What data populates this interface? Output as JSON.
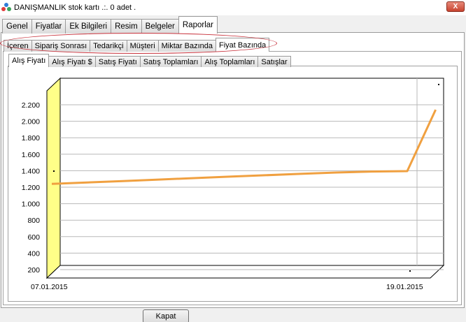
{
  "window": {
    "title": "DANIŞMANLIK stok kartı    .:.   0 adet .",
    "close_label": "X"
  },
  "main_tabs": [
    {
      "label": "Genel",
      "active": false
    },
    {
      "label": "Fiyatlar",
      "active": false
    },
    {
      "label": "Ek Bilgileri",
      "active": false
    },
    {
      "label": "Resim",
      "active": false
    },
    {
      "label": "Belgeler",
      "active": false
    },
    {
      "label": "Raporlar",
      "active": true
    }
  ],
  "sub_tabs": [
    {
      "label": "İçeren",
      "active": false
    },
    {
      "label": "Sipariş Sonrası",
      "active": false
    },
    {
      "label": "Tedarikçi",
      "active": false
    },
    {
      "label": "Müşteri",
      "active": false
    },
    {
      "label": "Miktar Bazında",
      "active": false
    },
    {
      "label": "Fiyat Bazında",
      "active": true
    }
  ],
  "chart_tabs": [
    {
      "label": "Alış Fiyatı",
      "active": true
    },
    {
      "label": "Alış Fiyatı $",
      "active": false
    },
    {
      "label": "Satış Fiyatı",
      "active": false
    },
    {
      "label": "Satış Toplamları",
      "active": false
    },
    {
      "label": "Alış Toplamları",
      "active": false
    },
    {
      "label": "Satışlar",
      "active": false
    }
  ],
  "chart_data": {
    "type": "line",
    "x": [
      "07.01.2015",
      "19.01.2015"
    ],
    "y_ticks": [
      "200",
      "400",
      "600",
      "800",
      "1.000",
      "1.200",
      "1.400",
      "1.600",
      "1.800",
      "2.000",
      "2.200"
    ],
    "ylim": [
      200,
      2200
    ],
    "series": [
      {
        "color": "#f0a040",
        "points": [
          {
            "t": 0.0,
            "v": 1240
          },
          {
            "t": 0.1,
            "v": 1258
          },
          {
            "t": 0.2,
            "v": 1275
          },
          {
            "t": 0.3,
            "v": 1292
          },
          {
            "t": 0.4,
            "v": 1310
          },
          {
            "t": 0.5,
            "v": 1328
          },
          {
            "t": 0.6,
            "v": 1345
          },
          {
            "t": 0.7,
            "v": 1362
          },
          {
            "t": 0.8,
            "v": 1378
          },
          {
            "t": 0.9,
            "v": 1390
          },
          {
            "t": 1.0,
            "v": 1395
          },
          {
            "t": 1.08,
            "v": 2140
          }
        ]
      }
    ],
    "grid": true,
    "wall_color": "#ffff88"
  },
  "footer": {
    "close_button": "Kapat"
  }
}
